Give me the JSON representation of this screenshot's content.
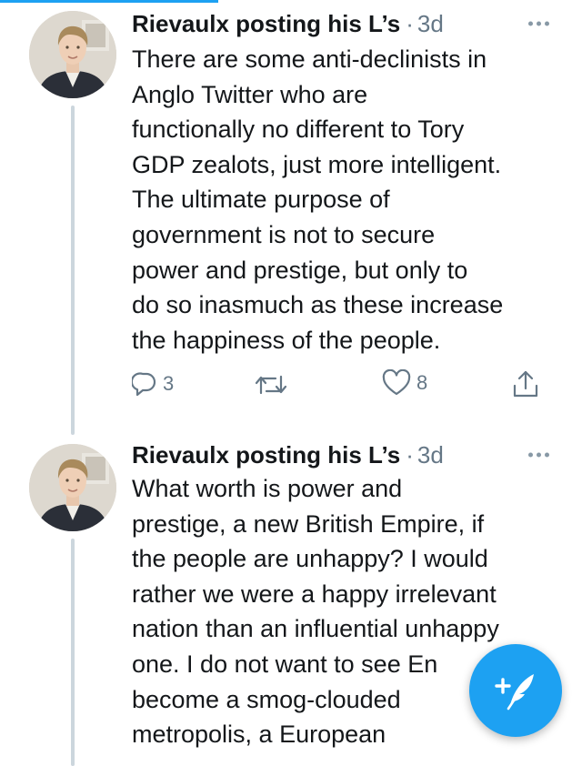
{
  "tweets": [
    {
      "author": "Rievaulx posting his L’s",
      "separator": "·",
      "time": "3d",
      "text": "There are some anti-declinists in\nAnglo Twitter who are\nfunctionally no different to Tory\nGDP zealots, just more intelligent.\nThe ultimate purpose of\ngovernment is not to secure\npower and prestige, but only to\ndo so inasmuch as these increase\nthe happiness of the people.",
      "replies": "3",
      "likes": "8"
    },
    {
      "author": "Rievaulx posting his L’s",
      "separator": "·",
      "time": "3d",
      "text": "What worth is power and\nprestige, a new British Empire, if\nthe people are unhappy? I would\nrather we were a happy irrelevant\nnation than an influential unhappy\none. I do not want to see En\nbecome a smog-clouded\nmetropolis, a European"
    }
  ],
  "icons": {
    "reply": "reply-icon",
    "retweet": "retweet-icon",
    "like": "heart-icon",
    "share": "share-icon",
    "more": "more-icon",
    "compose": "compose-tweet-icon"
  },
  "colors": {
    "accent": "#1da1f2",
    "text": "#14171a",
    "secondary": "#657786",
    "thread_line": "#ccd6dd"
  }
}
